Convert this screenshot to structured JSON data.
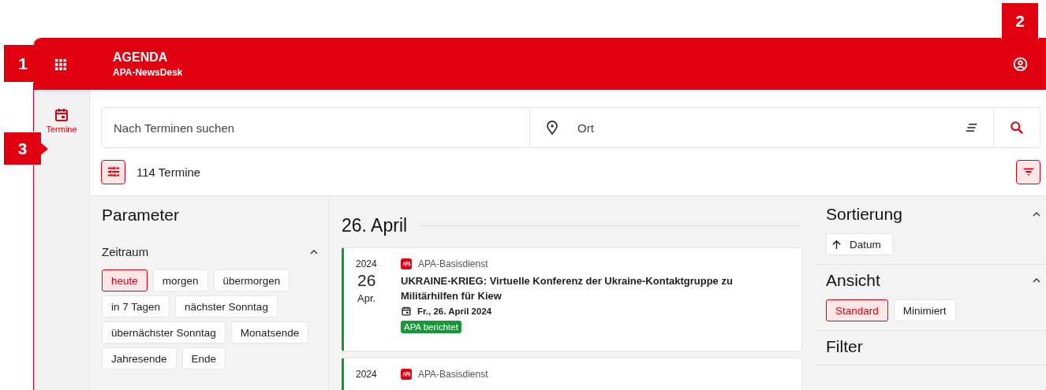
{
  "callouts": [
    {
      "label": "1"
    },
    {
      "label": "2"
    },
    {
      "label": "3"
    }
  ],
  "header": {
    "title": "AGENDA",
    "subtitle": "APA-NewsDesk"
  },
  "sidebar": {
    "items": [
      {
        "label": "Termine",
        "selected": true
      }
    ]
  },
  "search": {
    "placeholder": "Nach Terminen suchen",
    "location_placeholder": "Ort"
  },
  "results": {
    "count": "114 Termine"
  },
  "parameter": {
    "title": "Parameter",
    "sections": [
      {
        "title": "Zeitraum",
        "expanded": true,
        "chips": [
          {
            "label": "heute",
            "selected": true
          },
          {
            "label": "morgen",
            "selected": false
          },
          {
            "label": "übermorgen",
            "selected": false
          },
          {
            "label": "in 7 Tagen",
            "selected": false
          },
          {
            "label": "nächster Sonntag",
            "selected": false
          },
          {
            "label": "übernächster Sonntag",
            "selected": false
          },
          {
            "label": "Monatsende",
            "selected": false
          },
          {
            "label": "Jahresende",
            "selected": false
          },
          {
            "label": "Ende",
            "selected": false
          }
        ]
      }
    ]
  },
  "agenda": {
    "date_heading": "26. April",
    "events": [
      {
        "year": "2024",
        "day": "26",
        "month": "Apr.",
        "source": "APA-Basisdienst",
        "title": "UKRAINE-KRIEG: Virtuelle Konferenz der Ukraine-Kontaktgruppe zu Militärhilfen für Kiew",
        "date": "Fr., 26. April 2024",
        "badge": "APA berichtet"
      },
      {
        "year": "2024",
        "source": "APA-Basisdienst"
      }
    ]
  },
  "side_panel": {
    "sections": [
      {
        "title": "Sortierung",
        "expanded": true,
        "kind": "sort",
        "options": [
          {
            "label": "Datum"
          }
        ]
      },
      {
        "title": "Ansicht",
        "expanded": true,
        "kind": "choice",
        "options": [
          {
            "label": "Standard",
            "selected": true
          },
          {
            "label": "Minimiert",
            "selected": false
          }
        ]
      },
      {
        "title": "Filter"
      }
    ]
  }
}
